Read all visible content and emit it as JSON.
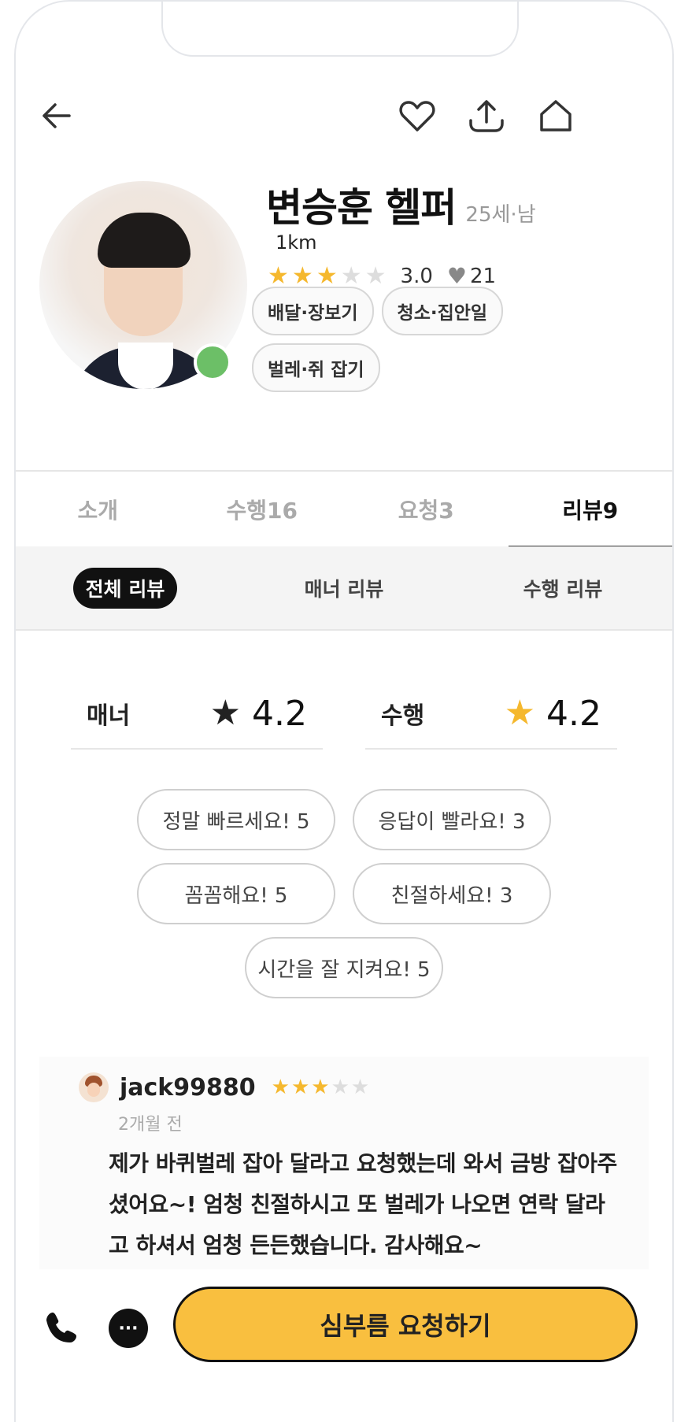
{
  "header": {
    "back_icon": "arrow-left-icon",
    "like_icon": "heart-icon",
    "share_icon": "share-upload-icon",
    "home_icon": "home-icon"
  },
  "profile": {
    "name": "변승훈  헬퍼",
    "age_gender": "25세·남",
    "distance": "1km",
    "rating": 3,
    "rating_text": "3.0",
    "likes": "21",
    "online": true,
    "tags": [
      "배달·장보기",
      "청소·집안일",
      "벌레·쥐 잡기"
    ]
  },
  "tabs": [
    {
      "label": "소개",
      "active": false
    },
    {
      "label": "수행16",
      "active": false
    },
    {
      "label": "요청3",
      "active": false
    },
    {
      "label": "리뷰9",
      "active": true
    }
  ],
  "subtabs": [
    {
      "label": "전체 리뷰",
      "active": true
    },
    {
      "label": "매너 리뷰",
      "active": false
    },
    {
      "label": "수행 리뷰",
      "active": false
    }
  ],
  "scores": {
    "manner": {
      "label": "매너",
      "value": "4.2",
      "star_color": "#222222"
    },
    "performance": {
      "label": "수행",
      "value": "4.2",
      "star_color": "#f5b82e"
    }
  },
  "keyword_chips": [
    [
      "정말 빠르세요! 5",
      "응답이 빨라요! 3"
    ],
    [
      "꼼꼼해요! 5",
      "친절하세요! 3"
    ],
    [
      "시간을 잘 지켜요! 5"
    ]
  ],
  "review": {
    "user_id": "jack99880",
    "rating": 3,
    "date": "2개월 전",
    "text": "제가 바퀴벌레 잡아 달라고 요청했는데 와서 금방 잡아주셨어요~! 엄청 친절하시고 또 벌레가 나오면 연락 달라고 하셔서 엄청 든든했습니다. 감사해요~"
  },
  "bottom": {
    "call_icon": "phone-icon",
    "chat_icon": "chat-bubble-icon",
    "chat_glyph": "···",
    "request_label": "심부름 요청하기"
  },
  "colors": {
    "accent": "#f9bf3f",
    "star_on": "#f5b82e",
    "star_off": "#dddddd",
    "online": "#6cbf67"
  }
}
